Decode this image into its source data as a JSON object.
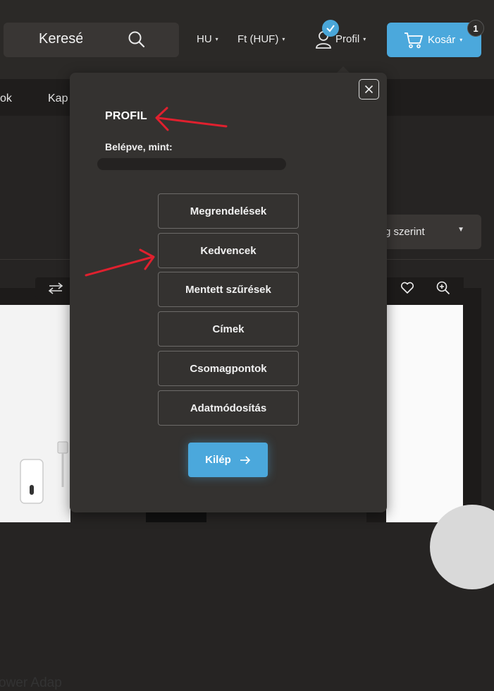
{
  "header": {
    "search_text": "Keresés",
    "language": "HU",
    "currency": "Ft (HUF)",
    "profile_label": "Profil",
    "cart_label": "Kosár",
    "cart_count": "1",
    "accent_color": "#4ba8dc"
  },
  "nav": {
    "items": [
      "ok",
      "Kap"
    ]
  },
  "sort": {
    "label": "g szerint"
  },
  "product": {
    "partial_name": "ower Adap"
  },
  "profile_popup": {
    "title": "PROFIL",
    "logged_in_label": "Belépve, mint:",
    "menu": [
      {
        "label": "Megrendelések"
      },
      {
        "label": "Kedvencek"
      },
      {
        "label": "Mentett szűrések"
      },
      {
        "label": "Címek"
      },
      {
        "label": "Csomagpontok"
      },
      {
        "label": "Adatmódosítás"
      }
    ],
    "logout_label": "Kilép"
  }
}
